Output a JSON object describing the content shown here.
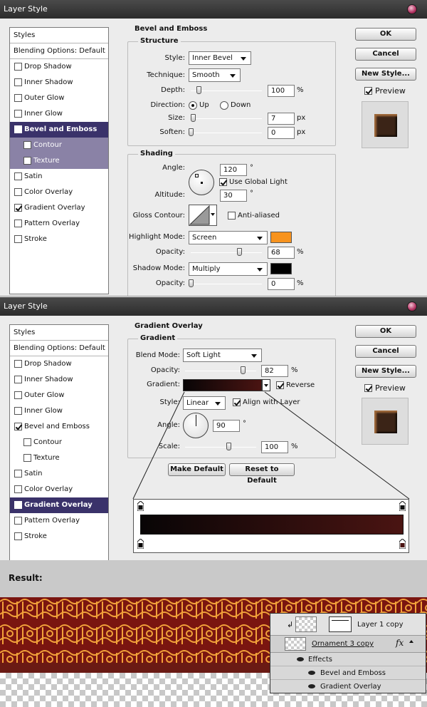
{
  "dialog1": {
    "title": "Layer Style",
    "styles_list": [
      {
        "label": "Styles",
        "type": "header"
      },
      {
        "label": "Blending Options: Default",
        "type": "header"
      },
      {
        "label": "Drop Shadow",
        "checked": false
      },
      {
        "label": "Inner Shadow",
        "checked": false
      },
      {
        "label": "Outer Glow",
        "checked": false
      },
      {
        "label": "Inner Glow",
        "checked": false
      },
      {
        "label": "Bevel and Emboss",
        "checked": true,
        "selected": true
      },
      {
        "label": "Contour",
        "checked": false,
        "sub": true
      },
      {
        "label": "Texture",
        "checked": false,
        "sub": true
      },
      {
        "label": "Satin",
        "checked": false
      },
      {
        "label": "Color Overlay",
        "checked": false
      },
      {
        "label": "Gradient Overlay",
        "checked": true
      },
      {
        "label": "Pattern Overlay",
        "checked": false
      },
      {
        "label": "Stroke",
        "checked": false
      }
    ],
    "section_title": "Bevel and Emboss",
    "structure": {
      "title": "Structure",
      "style_label": "Style:",
      "style_value": "Inner Bevel",
      "technique_label": "Technique:",
      "technique_value": "Smooth",
      "depth_label": "Depth:",
      "depth_value": "100",
      "depth_unit": "%",
      "direction_label": "Direction:",
      "dir_up": "Up",
      "dir_down": "Down",
      "size_label": "Size:",
      "size_value": "7",
      "size_unit": "px",
      "soften_label": "Soften:",
      "soften_value": "0",
      "soften_unit": "px"
    },
    "shading": {
      "title": "Shading",
      "angle_label": "Angle:",
      "angle_value": "120",
      "angle_unit": "°",
      "global_light": "Use Global Light",
      "altitude_label": "Altitude:",
      "altitude_value": "30",
      "altitude_unit": "°",
      "gloss_label": "Gloss Contour:",
      "anti_aliased": "Anti-aliased",
      "highlight_label": "Highlight Mode:",
      "highlight_value": "Screen",
      "highlight_color": "#f7931e",
      "opacity1_label": "Opacity:",
      "opacity1_value": "68",
      "opacity1_unit": "%",
      "shadow_label": "Shadow Mode:",
      "shadow_value": "Multiply",
      "shadow_color": "#000000",
      "opacity2_label": "Opacity:",
      "opacity2_value": "0",
      "opacity2_unit": "%"
    },
    "buttons": {
      "ok": "OK",
      "cancel": "Cancel",
      "new_style": "New Style...",
      "preview": "Preview"
    }
  },
  "dialog2": {
    "title": "Layer Style",
    "styles_list": [
      {
        "label": "Styles",
        "type": "header"
      },
      {
        "label": "Blending Options: Default",
        "type": "header"
      },
      {
        "label": "Drop Shadow",
        "checked": false
      },
      {
        "label": "Inner Shadow",
        "checked": false
      },
      {
        "label": "Outer Glow",
        "checked": false
      },
      {
        "label": "Inner Glow",
        "checked": false
      },
      {
        "label": "Bevel and Emboss",
        "checked": true
      },
      {
        "label": "Contour",
        "checked": false,
        "sub": true
      },
      {
        "label": "Texture",
        "checked": false,
        "sub": true
      },
      {
        "label": "Satin",
        "checked": false
      },
      {
        "label": "Color Overlay",
        "checked": false
      },
      {
        "label": "Gradient Overlay",
        "checked": true,
        "selected": true
      },
      {
        "label": "Pattern Overlay",
        "checked": false
      },
      {
        "label": "Stroke",
        "checked": false
      }
    ],
    "section_title": "Gradient Overlay",
    "gradient": {
      "title": "Gradient",
      "blend_label": "Blend Mode:",
      "blend_value": "Soft Light",
      "opacity_label": "Opacity:",
      "opacity_value": "82",
      "opacity_unit": "%",
      "gradient_label": "Gradient:",
      "reverse": "Reverse",
      "style_label": "Style:",
      "style_value": "Linear",
      "align": "Align with Layer",
      "angle_label": "Angle:",
      "angle_value": "90",
      "angle_unit": "°",
      "scale_label": "Scale:",
      "scale_value": "100",
      "scale_unit": "%",
      "make_default": "Make Default",
      "reset_default": "Reset to Default",
      "gradient_start": "#080506",
      "gradient_end": "#4a1412"
    },
    "buttons": {
      "ok": "OK",
      "cancel": "Cancel",
      "new_style": "New Style...",
      "preview": "Preview"
    }
  },
  "result": {
    "label": "Result:",
    "layers": {
      "layer1": "Layer 1 copy",
      "layer2": "Ornament 3 copy",
      "effects": "Effects",
      "effect1": "Bevel and Emboss",
      "effect2": "Gradient Overlay",
      "fx": "fx"
    }
  }
}
